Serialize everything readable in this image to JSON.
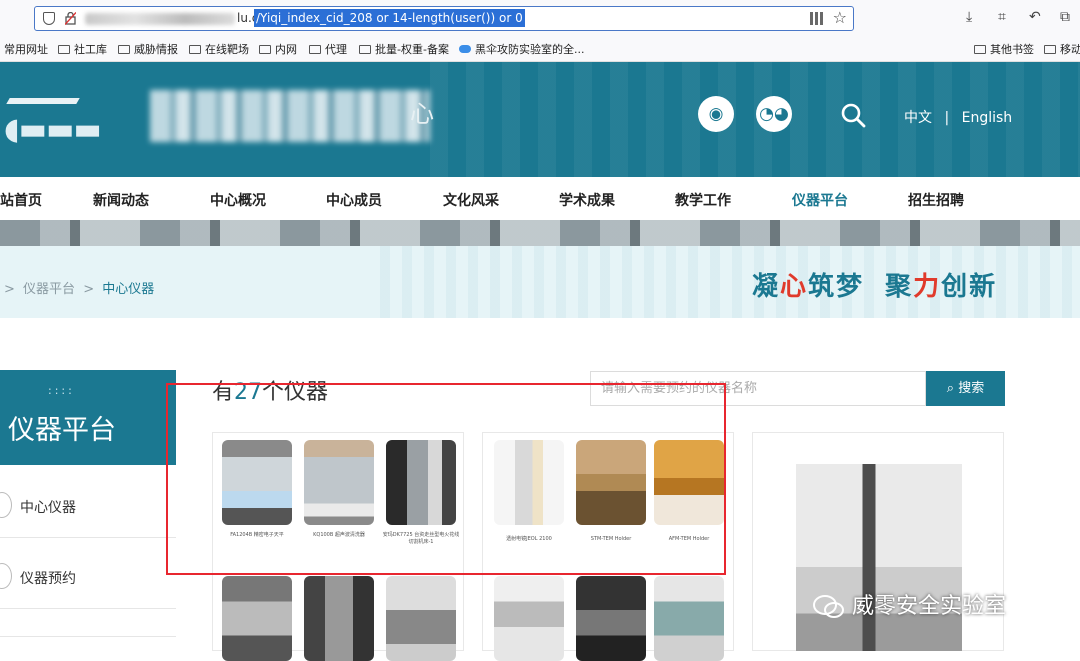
{
  "browser": {
    "url_host_tail": "lu.cn",
    "url_path": "/Yiqi_index_cid_208 or 14-length(user()) or 0",
    "bookmarks": [
      "常用网址",
      "社工库",
      "威胁情报",
      "在线靶场",
      "内网",
      "代理",
      "批量-权重-备案",
      "黑伞攻防实验室的全..."
    ],
    "bookmarks_right": [
      "其他书签",
      "移动"
    ]
  },
  "header": {
    "logo_tail": "心",
    "lang_cn": "中文",
    "lang_sep": "|",
    "lang_en": "English"
  },
  "nav": [
    "站首页",
    "新闻动态",
    "中心概况",
    "中心成员",
    "文化风采",
    "学术成果",
    "教学工作",
    "仪器平台",
    "招生招聘"
  ],
  "breadcrumb": {
    "sep1": ">",
    "parent": "仪器平台",
    "sep2": ">",
    "current": "中心仪器"
  },
  "slogan": {
    "p1": "凝",
    "r1": "心",
    "p2": "筑梦",
    "p3": "聚",
    "r2": "力",
    "p4": "创新"
  },
  "sidebar": {
    "dots": "::::",
    "title": "仪器平台",
    "items": [
      "中心仪器",
      "仪器预约"
    ]
  },
  "main": {
    "count_prefix": "有",
    "count": "27",
    "count_suffix": "个仪器",
    "search_placeholder": "请输入需要预约的仪器名称",
    "search_button": "搜索"
  },
  "cards": [
    {
      "captions": [
        "FA1204B 精密电子天平",
        "KQ100B 超声波清洗器",
        "安玛DK7725 台资走丝型电火花线切割机床-1"
      ]
    },
    {
      "captions": [
        "透射电镜JEOL 2100",
        "STM-TEM Holder",
        "AFM-TEM Holder"
      ]
    }
  ],
  "watermark": "威零安全实验室",
  "colors": {
    "brand": "#1b7891",
    "highlight": "#e8262f",
    "accent_red": "#e03a2b"
  }
}
